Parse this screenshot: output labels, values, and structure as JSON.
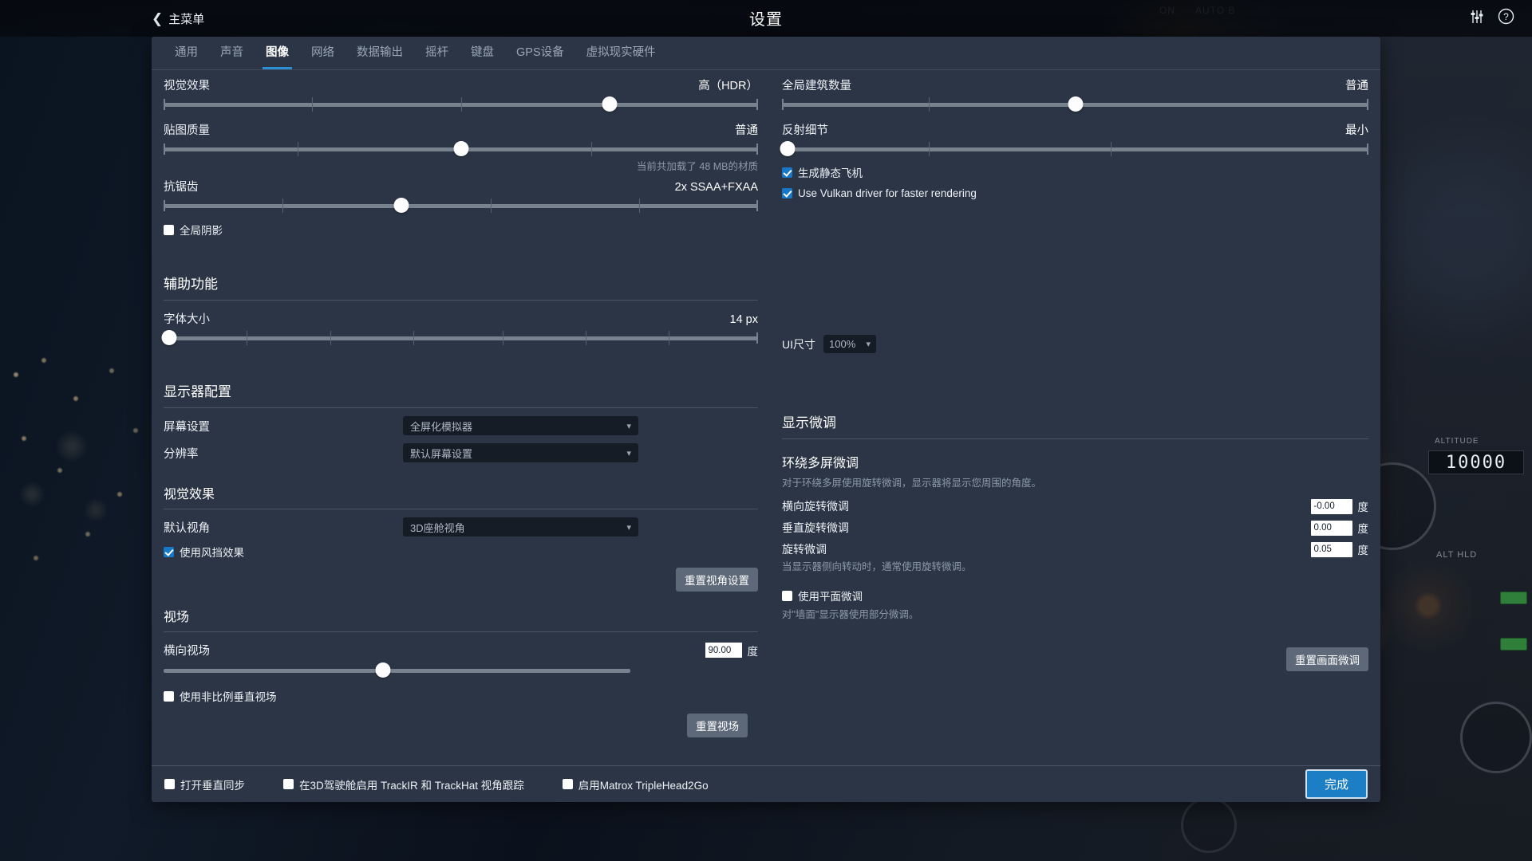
{
  "topbar": {
    "back_label": "主菜单",
    "title": "设置",
    "sliders_icon": "sliders-icon",
    "help_icon": "help-circle-icon"
  },
  "tabs": [
    {
      "label": "通用",
      "active": false
    },
    {
      "label": "声音",
      "active": false
    },
    {
      "label": "图像",
      "active": true
    },
    {
      "label": "网络",
      "active": false
    },
    {
      "label": "数据输出",
      "active": false
    },
    {
      "label": "摇杆",
      "active": false
    },
    {
      "label": "键盘",
      "active": false
    },
    {
      "label": "GPS设备",
      "active": false
    },
    {
      "label": "虚拟现实硬件",
      "active": false
    }
  ],
  "graphics": {
    "visual_effects": {
      "label": "视觉效果",
      "value": "高（HDR）",
      "percent": 75,
      "ticks": [
        25,
        50
      ]
    },
    "texture_quality": {
      "label": "贴图质量",
      "value": "普通",
      "percent": 50,
      "ticks": [
        25,
        50,
        75,
        100
      ]
    },
    "texture_hint": "当前共加载了 48 MB的材质",
    "anti_aliasing": {
      "label": "抗锯齿",
      "value": "2x SSAA+FXAA",
      "percent": 40,
      "ticks": [
        20,
        55,
        80
      ]
    },
    "global_shadows": {
      "label": "全局阴影",
      "checked": false
    },
    "building_count": {
      "label": "全局建筑数量",
      "value": "普通",
      "percent": 50,
      "ticks": [
        25,
        50,
        70
      ]
    },
    "reflection_detail": {
      "label": "反射细节",
      "value": "最小",
      "percent": 0,
      "ticks": [
        25,
        50,
        72
      ]
    },
    "static_aircraft": {
      "label": "生成静态飞机",
      "checked": true
    },
    "vulkan": {
      "label": "Use Vulkan driver for faster rendering",
      "checked": true
    }
  },
  "accessibility": {
    "title": "辅助功能",
    "font_size": {
      "label": "字体大小",
      "value": "14 px",
      "percent": 1,
      "ticks": [
        14,
        28,
        42,
        57,
        71,
        85,
        100
      ]
    },
    "ui_scale": {
      "label": "UI尺寸",
      "value": "100%"
    }
  },
  "display_config": {
    "title": "显示器配置",
    "screen_setting": {
      "label": "屏幕设置",
      "value": "全屏化模拟器"
    },
    "resolution": {
      "label": "分辨率",
      "value": "默认屏幕设置"
    }
  },
  "visual_effects_section": {
    "title": "视觉效果",
    "default_view": {
      "label": "默认视角",
      "value": "3D座舱视角"
    },
    "windshield_effects": {
      "label": "使用风挡效果",
      "checked": true
    },
    "reset_view_button": "重置视角设置"
  },
  "fov_section": {
    "title": "视场",
    "horizontal_fov": {
      "label": "横向视场",
      "value": "90.00",
      "unit": "度",
      "percent": 47
    },
    "non_proportional": {
      "label": "使用非比例垂直视场",
      "checked": false
    },
    "reset_fov_button": "重置视场"
  },
  "display_tuning": {
    "title": "显示微调",
    "surround": {
      "title": "环绕多屏微调",
      "description": "对于环绕多屏使用旋转微调，显示器将显示您周围的角度。",
      "fields": [
        {
          "label": "横向旋转微调",
          "value": "-0.00",
          "unit": "度"
        },
        {
          "label": "垂直旋转微调",
          "value": "0.00",
          "unit": "度"
        },
        {
          "label": "旋转微调",
          "value": "0.05",
          "unit": "度"
        }
      ],
      "rotation_hint": "当显示器侧向转动时，通常使用旋转微调。"
    },
    "flat_tuning": {
      "label": "使用平面微调",
      "checked": false
    },
    "flat_hint": "对\"墙面\"显示器使用部分微调。",
    "reset_button": "重置画面微调"
  },
  "footer": {
    "vsync": {
      "label": "打开垂直同步",
      "checked": false
    },
    "trackir": {
      "label": "在3D驾驶舱启用 TrackIR 和 TrackHat 视角跟踪",
      "checked": false
    },
    "matrox": {
      "label": "启用Matrox TripleHead2Go",
      "checked": false
    },
    "done_label": "完成"
  },
  "colors": {
    "accent": "#2b8fd6",
    "panel": "#2b3545",
    "done_button": "#1c7ec4"
  },
  "background": {
    "altitude_label": "ALTITUDE",
    "altitude_value": "10000",
    "alt_hld_label": "ALT HLD",
    "on_label": "ON",
    "auto_label": "AUTO B"
  }
}
